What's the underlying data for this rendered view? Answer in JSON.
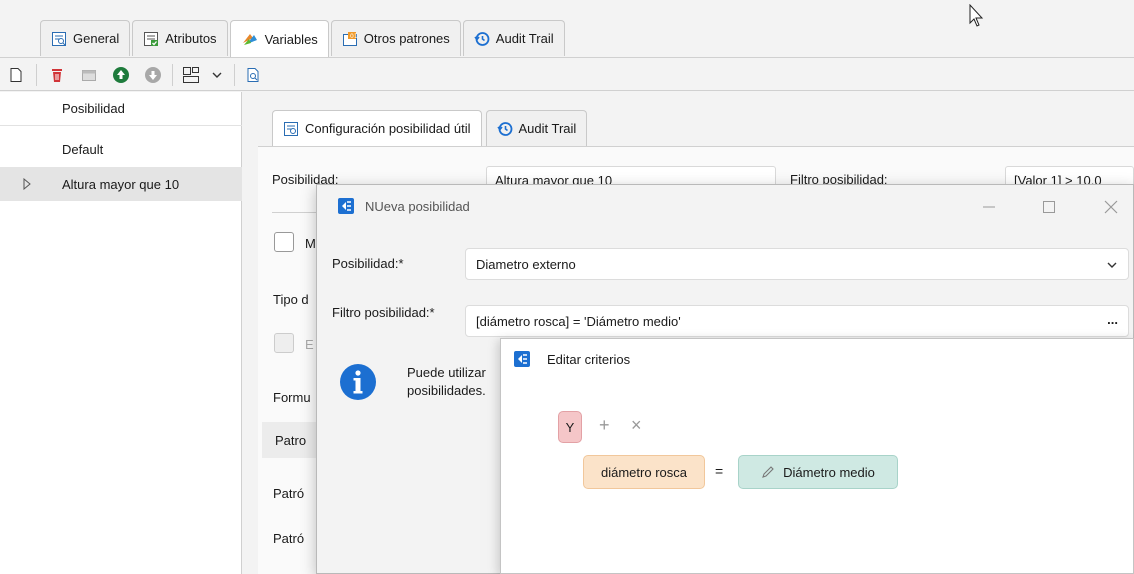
{
  "top_tabs": [
    {
      "label": "General",
      "icon": "report-icon"
    },
    {
      "label": "Atributos",
      "icon": "attributes-icon"
    },
    {
      "label": "Variables",
      "icon": "variables-icon"
    },
    {
      "label": "Otros patrones",
      "icon": "patterns-icon"
    },
    {
      "label": "Audit Trail",
      "icon": "history-icon"
    }
  ],
  "left_list": {
    "header": "Posibilidad",
    "items": [
      "Default",
      "Altura mayor que 10"
    ]
  },
  "sub_tabs": [
    {
      "label": "Configuración posibilidad útil"
    },
    {
      "label": "Audit Trail"
    }
  ],
  "form": {
    "posibilidad_label": "Posibilidad:",
    "posibilidad_value": "Altura mayor que 10",
    "filtro_label": "Filtro posibilidad:",
    "filtro_value": "[Valor 1] > 10.0",
    "partial_m": "M",
    "partial_tipo": "Tipo d",
    "partial_e": "E",
    "partial_formu": "Formu",
    "partial_patro": "Patro",
    "partial_patron1": "Patró",
    "partial_patron2": "Patró"
  },
  "dialog": {
    "title": "NUeva posibilidad",
    "posibilidad_label": "Posibilidad:*",
    "posibilidad_value": "Diametro externo",
    "filtro_label": "Filtro posibilidad:*",
    "filtro_value": "[diámetro rosca] = 'Diámetro medio'",
    "more_label": "...",
    "info_line1": "Puede utilizar",
    "info_line2": "posibilidades."
  },
  "editar": {
    "title": "Editar criterios",
    "operator": "Y",
    "plus": "+",
    "times": "×",
    "field": "diámetro rosca",
    "equals": "=",
    "value": "Diámetro medio"
  },
  "colors": {
    "accent_blue": "#1c6fd1",
    "chip_operator_bg": "#f5c6c8",
    "chip_field_bg": "#fbe3c9",
    "chip_value_bg": "#cfe9e3"
  }
}
